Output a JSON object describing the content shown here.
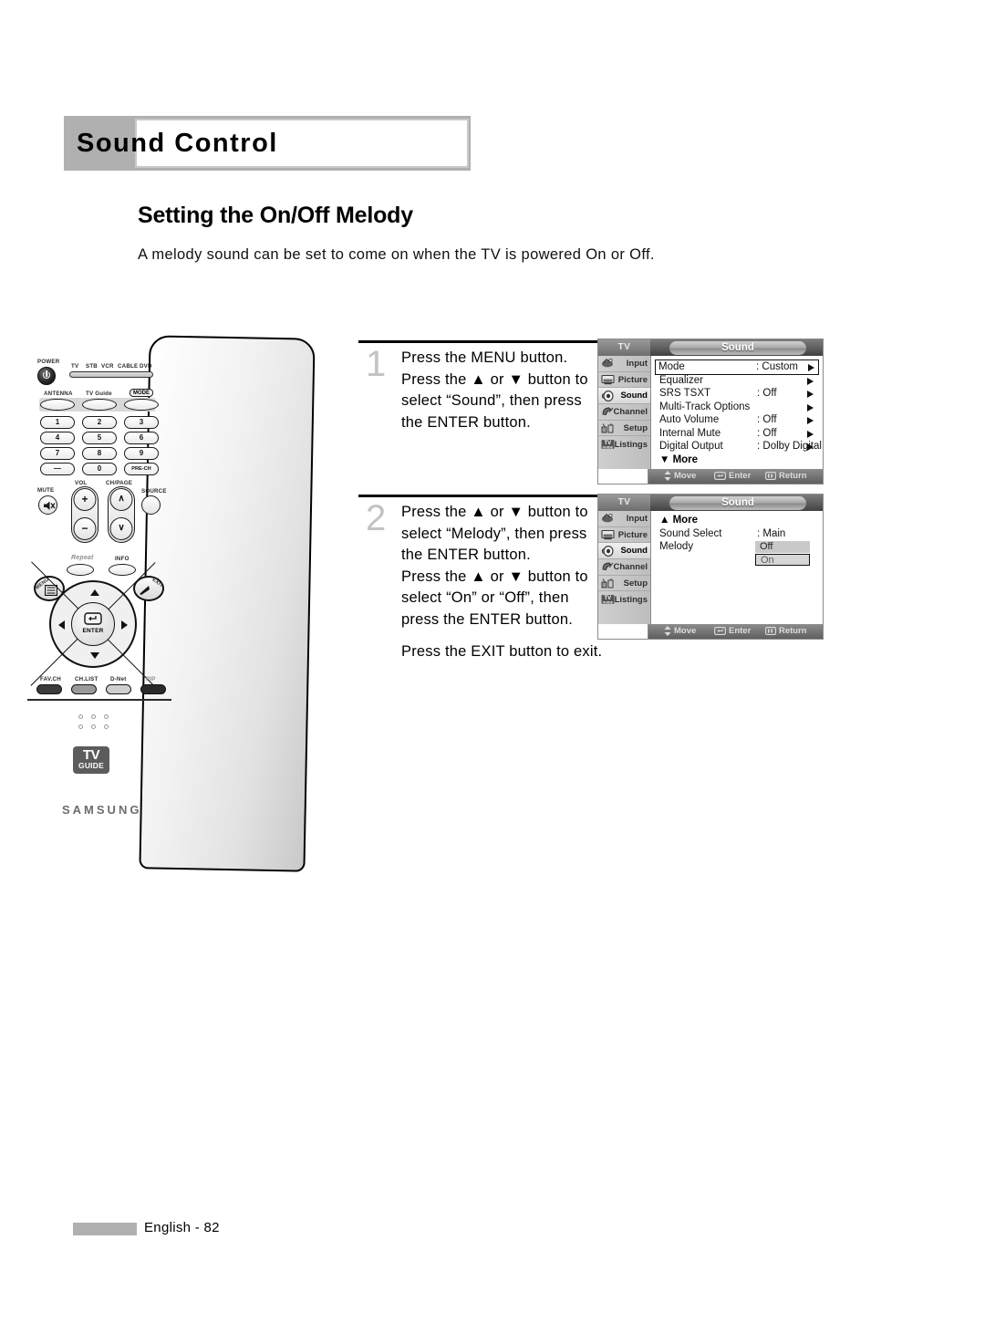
{
  "page": {
    "chapter_title": "Sound Control",
    "section_title": "Setting the On/Off Melody",
    "intro": "A melody sound can be set to come on when the TV is powered On or Off.",
    "footer_label": "English - 82"
  },
  "steps": [
    {
      "number": "1",
      "lines": [
        "Press the MENU button.",
        "Press the ▲ or ▼ button to",
        "select “Sound”, then press",
        "the ENTER button."
      ]
    },
    {
      "number": "2",
      "lines": [
        "Press the ▲ or ▼ button to",
        "select “Melody”, then press",
        "the ENTER button.",
        "Press the ▲ or ▼ button to",
        "select “On” or “Off”, then",
        "press the ENTER button."
      ],
      "trailing": "Press the EXIT button to exit."
    }
  ],
  "remote": {
    "power_label": "POWER",
    "device_labels": [
      "TV",
      "STB",
      "VCR",
      "CABLE",
      "DVD"
    ],
    "antenna_label": "ANTENNA",
    "tvguide_label": "TV Guide",
    "mode_label": "MODE",
    "keys": [
      "1",
      "2",
      "3",
      "4",
      "5",
      "6",
      "7",
      "8",
      "9",
      "—",
      "0",
      "PRE-CH"
    ],
    "mute_label": "MUTE",
    "vol_label": "VOL",
    "chpage_label": "CH/PAGE",
    "source_label": "SOURCE",
    "repeat_label": "Repeat",
    "info_label": "INFO",
    "menu_label": "MENU",
    "exit_label": "EXIT",
    "enter_label": "ENTER",
    "bottom_keys": [
      "FAV.CH",
      "CH.LIST",
      "D-Net",
      "PIP"
    ],
    "tvguide_logo_top": "TV",
    "tvguide_logo_bottom": "GUIDE",
    "brand": "SAMSUNG"
  },
  "osd": {
    "tv_tab": "TV",
    "title": "Sound",
    "sidebar": [
      {
        "label": "Input",
        "icon": "input-icon",
        "active": false
      },
      {
        "label": "Picture",
        "icon": "picture-icon",
        "active": false
      },
      {
        "label": "Sound",
        "icon": "sound-icon",
        "active": true
      },
      {
        "label": "Channel",
        "icon": "channel-icon",
        "active": false
      },
      {
        "label": "Setup",
        "icon": "setup-icon",
        "active": false
      },
      {
        "label": "Listings",
        "icon": "listings-icon",
        "active": false
      }
    ],
    "footer": [
      {
        "label": "Move",
        "icon": "updown-arrow-icon"
      },
      {
        "label": "Enter",
        "icon": "enter-key-icon"
      },
      {
        "label": "Return",
        "icon": "return-key-icon"
      }
    ],
    "screen1": {
      "rows": [
        {
          "label": "Mode",
          "value": ": Custom",
          "arrow": true,
          "selected": true
        },
        {
          "label": "Equalizer",
          "value": "",
          "arrow": true,
          "selected": false
        },
        {
          "label": "SRS TSXT",
          "value": ": Off",
          "arrow": true,
          "selected": false
        },
        {
          "label": "Multi-Track Options",
          "value": "",
          "arrow": true,
          "selected": false
        },
        {
          "label": "Auto Volume",
          "value": ": Off",
          "arrow": true,
          "selected": false
        },
        {
          "label": "Internal Mute",
          "value": ": Off",
          "arrow": true,
          "selected": false
        },
        {
          "label": "Digital Output",
          "value": ": Dolby Digital",
          "arrow": true,
          "selected": false
        }
      ],
      "more": "▼ More"
    },
    "screen2": {
      "more": "▲ More",
      "rows": [
        {
          "label": "Sound Select",
          "value": ": Main"
        },
        {
          "label": "Melody",
          "value": ""
        }
      ],
      "options": [
        {
          "label": "Off",
          "state": "unselected"
        },
        {
          "label": "On",
          "state": "selected"
        }
      ]
    }
  }
}
